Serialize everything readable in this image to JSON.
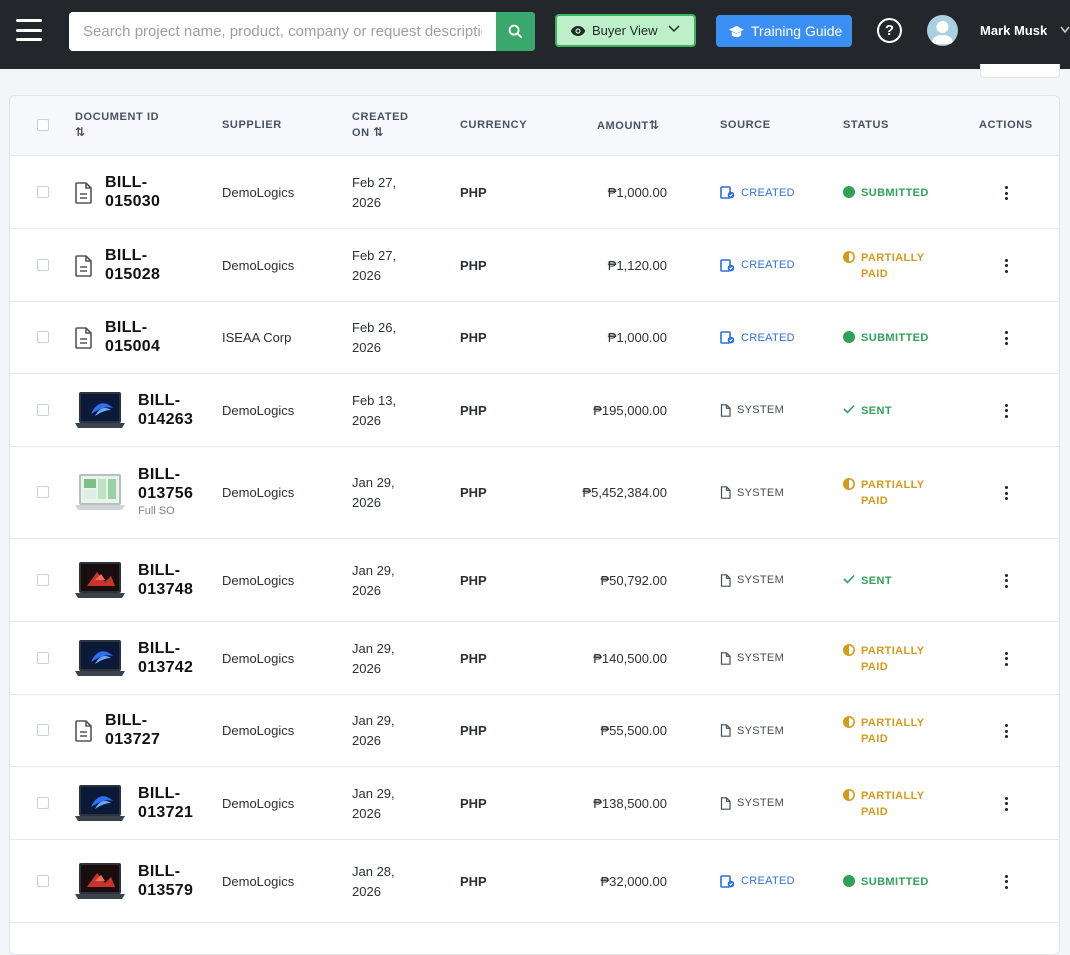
{
  "header": {
    "search_placeholder": "Search project name, product, company or request description",
    "buyer_view_label": "Buyer View",
    "training_label": "Training Guide",
    "help_glyph": "?",
    "username": "Mark Musk"
  },
  "table": {
    "columns": {
      "document_id": "DOCUMENT ID",
      "supplier": "SUPPLIER",
      "created_on_1": "CREATED",
      "created_on_2": "ON",
      "currency": "CURRENCY",
      "amount": "AMOUNT",
      "source": "SOURCE",
      "status": "STATUS",
      "actions": "ACTIONS"
    },
    "sort_glyph": "⇅",
    "rows": [
      {
        "id1": "BILL-",
        "id2": "015030",
        "sub": "",
        "thumb": "doc-icon",
        "supplier": "DemoLogics",
        "date1": "Feb 27,",
        "date2": "2026",
        "currency": "PHP",
        "amount": "₱1,000.00",
        "source": "CREATED",
        "status1": "SUBMITTED",
        "status2": "",
        "status_type": "submitted"
      },
      {
        "id1": "BILL-",
        "id2": "015028",
        "sub": "",
        "thumb": "doc-icon",
        "supplier": "DemoLogics",
        "date1": "Feb 27,",
        "date2": "2026",
        "currency": "PHP",
        "amount": "₱1,120.00",
        "source": "CREATED",
        "status1": "PARTIALLY",
        "status2": "PAID",
        "status_type": "partial"
      },
      {
        "id1": "BILL-",
        "id2": "015004",
        "sub": "",
        "thumb": "doc-icon",
        "supplier": "ISEAA Corp",
        "date1": "Feb 26,",
        "date2": "2026",
        "currency": "PHP",
        "amount": "₱1,000.00",
        "source": "CREATED",
        "status1": "SUBMITTED",
        "status2": "",
        "status_type": "submitted"
      },
      {
        "id1": "BILL-",
        "id2": "014263",
        "sub": "",
        "thumb": "laptop-blue",
        "supplier": "DemoLogics",
        "date1": "Feb 13,",
        "date2": "2026",
        "currency": "PHP",
        "amount": "₱195,000.00",
        "source": "SYSTEM",
        "status1": "SENT",
        "status2": "",
        "status_type": "sent"
      },
      {
        "id1": "BILL-",
        "id2": "013756",
        "sub": "Full SO",
        "thumb": "laptop-silver",
        "supplier": "DemoLogics",
        "date1": "Jan 29,",
        "date2": "2026",
        "currency": "PHP",
        "amount": "₱5,452,384.00",
        "source": "SYSTEM",
        "status1": "PARTIALLY",
        "status2": "PAID",
        "status_type": "partial"
      },
      {
        "id1": "BILL-",
        "id2": "013748",
        "sub": "",
        "thumb": "laptop-red",
        "supplier": "DemoLogics",
        "date1": "Jan 29,",
        "date2": "2026",
        "currency": "PHP",
        "amount": "₱50,792.00",
        "source": "SYSTEM",
        "status1": "SENT",
        "status2": "",
        "status_type": "sent"
      },
      {
        "id1": "BILL-",
        "id2": "013742",
        "sub": "",
        "thumb": "laptop-blue",
        "supplier": "DemoLogics",
        "date1": "Jan 29,",
        "date2": "2026",
        "currency": "PHP",
        "amount": "₱140,500.00",
        "source": "SYSTEM",
        "status1": "PARTIALLY",
        "status2": "PAID",
        "status_type": "partial"
      },
      {
        "id1": "BILL-",
        "id2": "013727",
        "sub": "",
        "thumb": "doc-icon",
        "supplier": "DemoLogics",
        "date1": "Jan 29,",
        "date2": "2026",
        "currency": "PHP",
        "amount": "₱55,500.00",
        "source": "SYSTEM",
        "status1": "PARTIALLY",
        "status2": "PAID",
        "status_type": "partial"
      },
      {
        "id1": "BILL-",
        "id2": "013721",
        "sub": "",
        "thumb": "laptop-blue",
        "supplier": "DemoLogics",
        "date1": "Jan 29,",
        "date2": "2026",
        "currency": "PHP",
        "amount": "₱138,500.00",
        "source": "SYSTEM",
        "status1": "PARTIALLY",
        "status2": "PAID",
        "status_type": "partial"
      },
      {
        "id1": "BILL-",
        "id2": "013579",
        "sub": "",
        "thumb": "laptop-red",
        "supplier": "DemoLogics",
        "date1": "Jan 28,",
        "date2": "2026",
        "currency": "PHP",
        "amount": "₱32,000.00",
        "source": "CREATED",
        "status1": "SUBMITTED",
        "status2": "",
        "status_type": "submitted"
      }
    ]
  },
  "colors": {
    "topbar": "#23272b",
    "search_button": "#3aa76d",
    "buyer_view_bg": "#bdf0c9",
    "training_bg": "#3b8ff3",
    "created": "#2d6fd9",
    "submitted": "#2fa25a",
    "partial": "#d49a1a"
  }
}
